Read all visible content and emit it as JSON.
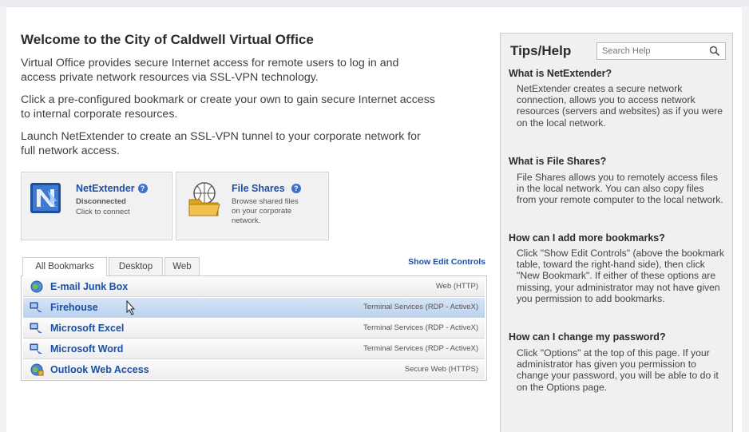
{
  "welcome": {
    "title": "Welcome to the City of Caldwell Virtual Office",
    "p1": "Virtual Office provides secure Internet access for remote users to log in and access private network resources via SSL-VPN technology.",
    "p2": "Click a pre-configured bookmark or create your own to gain secure Internet access to internal corporate resources.",
    "p3": "Launch NetExtender to create an SSL-VPN tunnel to your corporate network for full network access."
  },
  "tiles": {
    "netextender": {
      "title": "NetExtender",
      "status": "Disconnected",
      "action": "Click to connect"
    },
    "fileshares": {
      "title": "File Shares",
      "line1": "Browse shared files",
      "line2": "on your corporate",
      "line3": "network."
    }
  },
  "bookmarks": {
    "tabs": [
      "All Bookmarks",
      "Desktop",
      "Web"
    ],
    "show_edit": "Show Edit Controls",
    "rows": [
      {
        "name": "E-mail Junk Box",
        "type": "Web (HTTP)"
      },
      {
        "name": "Firehouse",
        "type": "Terminal Services (RDP - ActiveX)"
      },
      {
        "name": "Microsoft Excel",
        "type": "Terminal Services (RDP - ActiveX)"
      },
      {
        "name": "Microsoft Word",
        "type": "Terminal Services (RDP - ActiveX)"
      },
      {
        "name": "Outlook Web Access",
        "type": "Secure Web (HTTPS)"
      }
    ]
  },
  "tips": {
    "title": "Tips/Help",
    "search_placeholder": "Search Help",
    "items": [
      {
        "q": "What is NetExtender?",
        "a": "NetExtender creates a secure network connection, allows you to access network resources (servers and websites) as if you were on the local network."
      },
      {
        "q": "What is File Shares?",
        "a": "File Shares allows you to remotely access files in the local network. You can also copy files from your remote computer to the local network."
      },
      {
        "q": "How can I add more bookmarks?",
        "a": "Click \"Show Edit Controls\" (above the bookmark table, toward the right-hand side), then click \"New Bookmark\". If either of these options are missing, your administrator may not have given you permission to add bookmarks."
      },
      {
        "q": "How can I change my password?",
        "a": "Click \"Options\" at the top of this page. If your administrator has given you permission to change your password, you will be able to do it on the Options page."
      }
    ]
  },
  "colors": {
    "link": "#1d4fa0",
    "highlight_row": "#c9dcf3"
  }
}
